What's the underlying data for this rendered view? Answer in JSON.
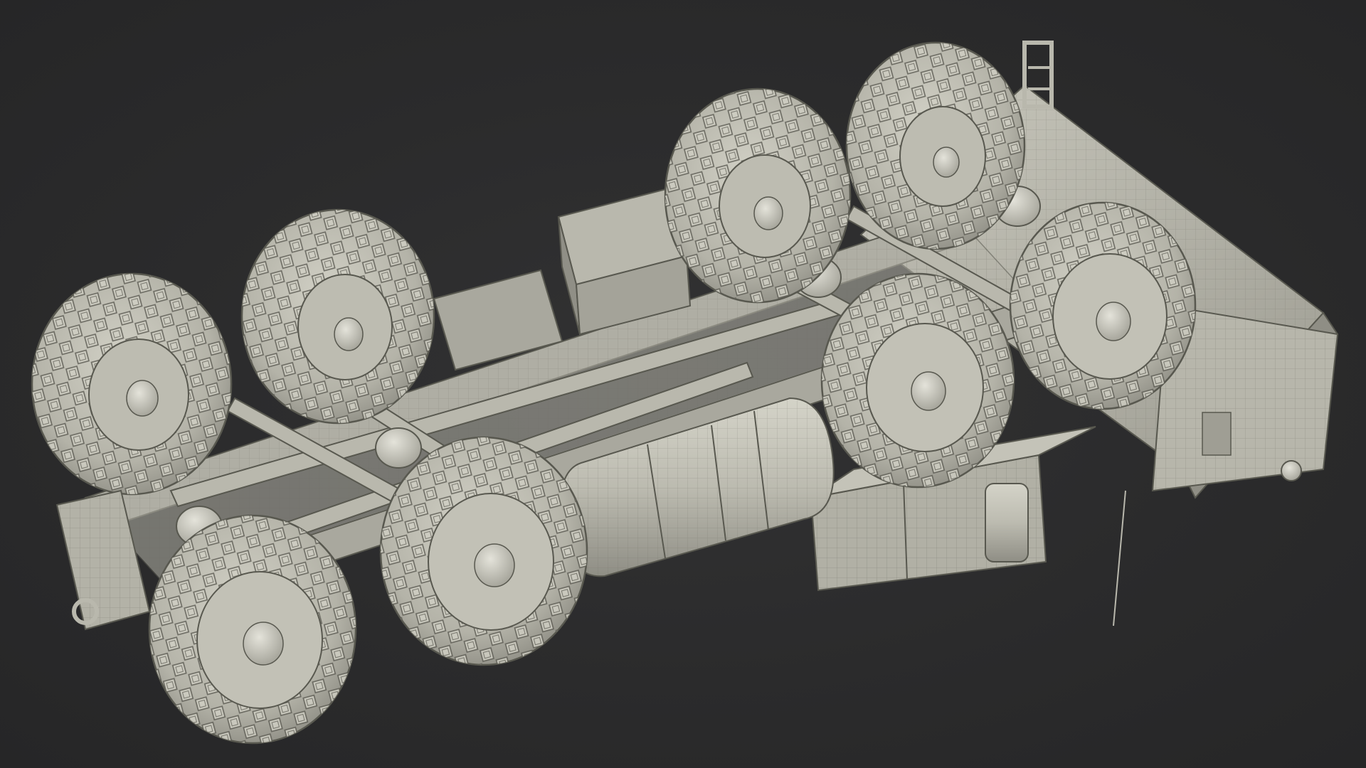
{
  "scene": {
    "subject": "wireframe-render-8x8-military-truck-chassis-underside",
    "background_color": "#2b2b2c",
    "model_fill_color": "#b9b8ad",
    "model_shade_color": "#8f8e85",
    "wire_color": "#58584f",
    "wheel_count": 8,
    "view": "underside-isometric"
  }
}
